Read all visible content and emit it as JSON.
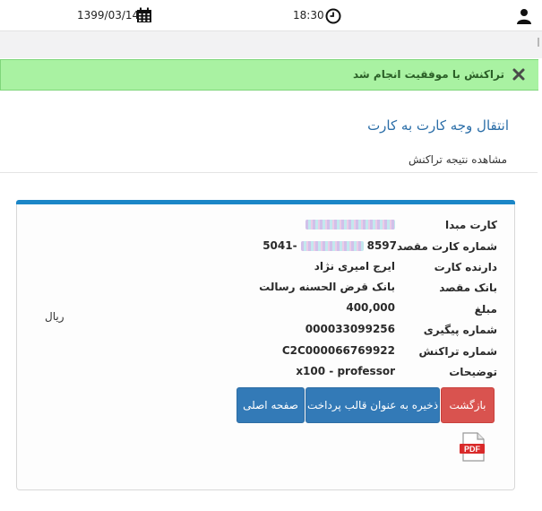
{
  "topbar": {
    "date": "1399/03/14",
    "time": "18:30",
    "icons": [
      "calendar-icon",
      "clock-icon",
      "user-icon"
    ]
  },
  "alert": {
    "message": "تراکنش با موفقیت انجام شد",
    "color": "#a9f2a2",
    "icon": "close-icon"
  },
  "page": {
    "title": "انتقال وجه کارت به کارت",
    "subtitle": "مشاهده نتیجه تراکنش"
  },
  "details": {
    "rows": [
      {
        "label": "کارت مبدا",
        "value": ""
      },
      {
        "label": "شماره کارت مقصد",
        "value_start": "5041-",
        "value_end": "8597"
      },
      {
        "label": "دارنده کارت",
        "value": "ایرج امیری نژاد"
      },
      {
        "label": "بانک مقصد",
        "value": "بانک قرض الحسنه رسالت"
      },
      {
        "label": "مبلغ",
        "value": "400,000"
      },
      {
        "label": "شماره پیگیری",
        "value": "000033099256"
      },
      {
        "label": "شماره تراکنش",
        "value": "C2C000066769922"
      },
      {
        "label": "توضیحات",
        "value": "x100 - professor"
      }
    ],
    "currency": "ریال"
  },
  "buttons": {
    "back": "بازگشت",
    "save_template": "ذخیره به عنوان قالب پرداخت",
    "home": "صفحه اصلی"
  },
  "colors": {
    "accent": "#1b86c7",
    "primary_button": "#337ab7",
    "danger_button": "#d9534f",
    "title": "#2b6ea8"
  },
  "pdf_icon": {
    "label": "PDF"
  }
}
